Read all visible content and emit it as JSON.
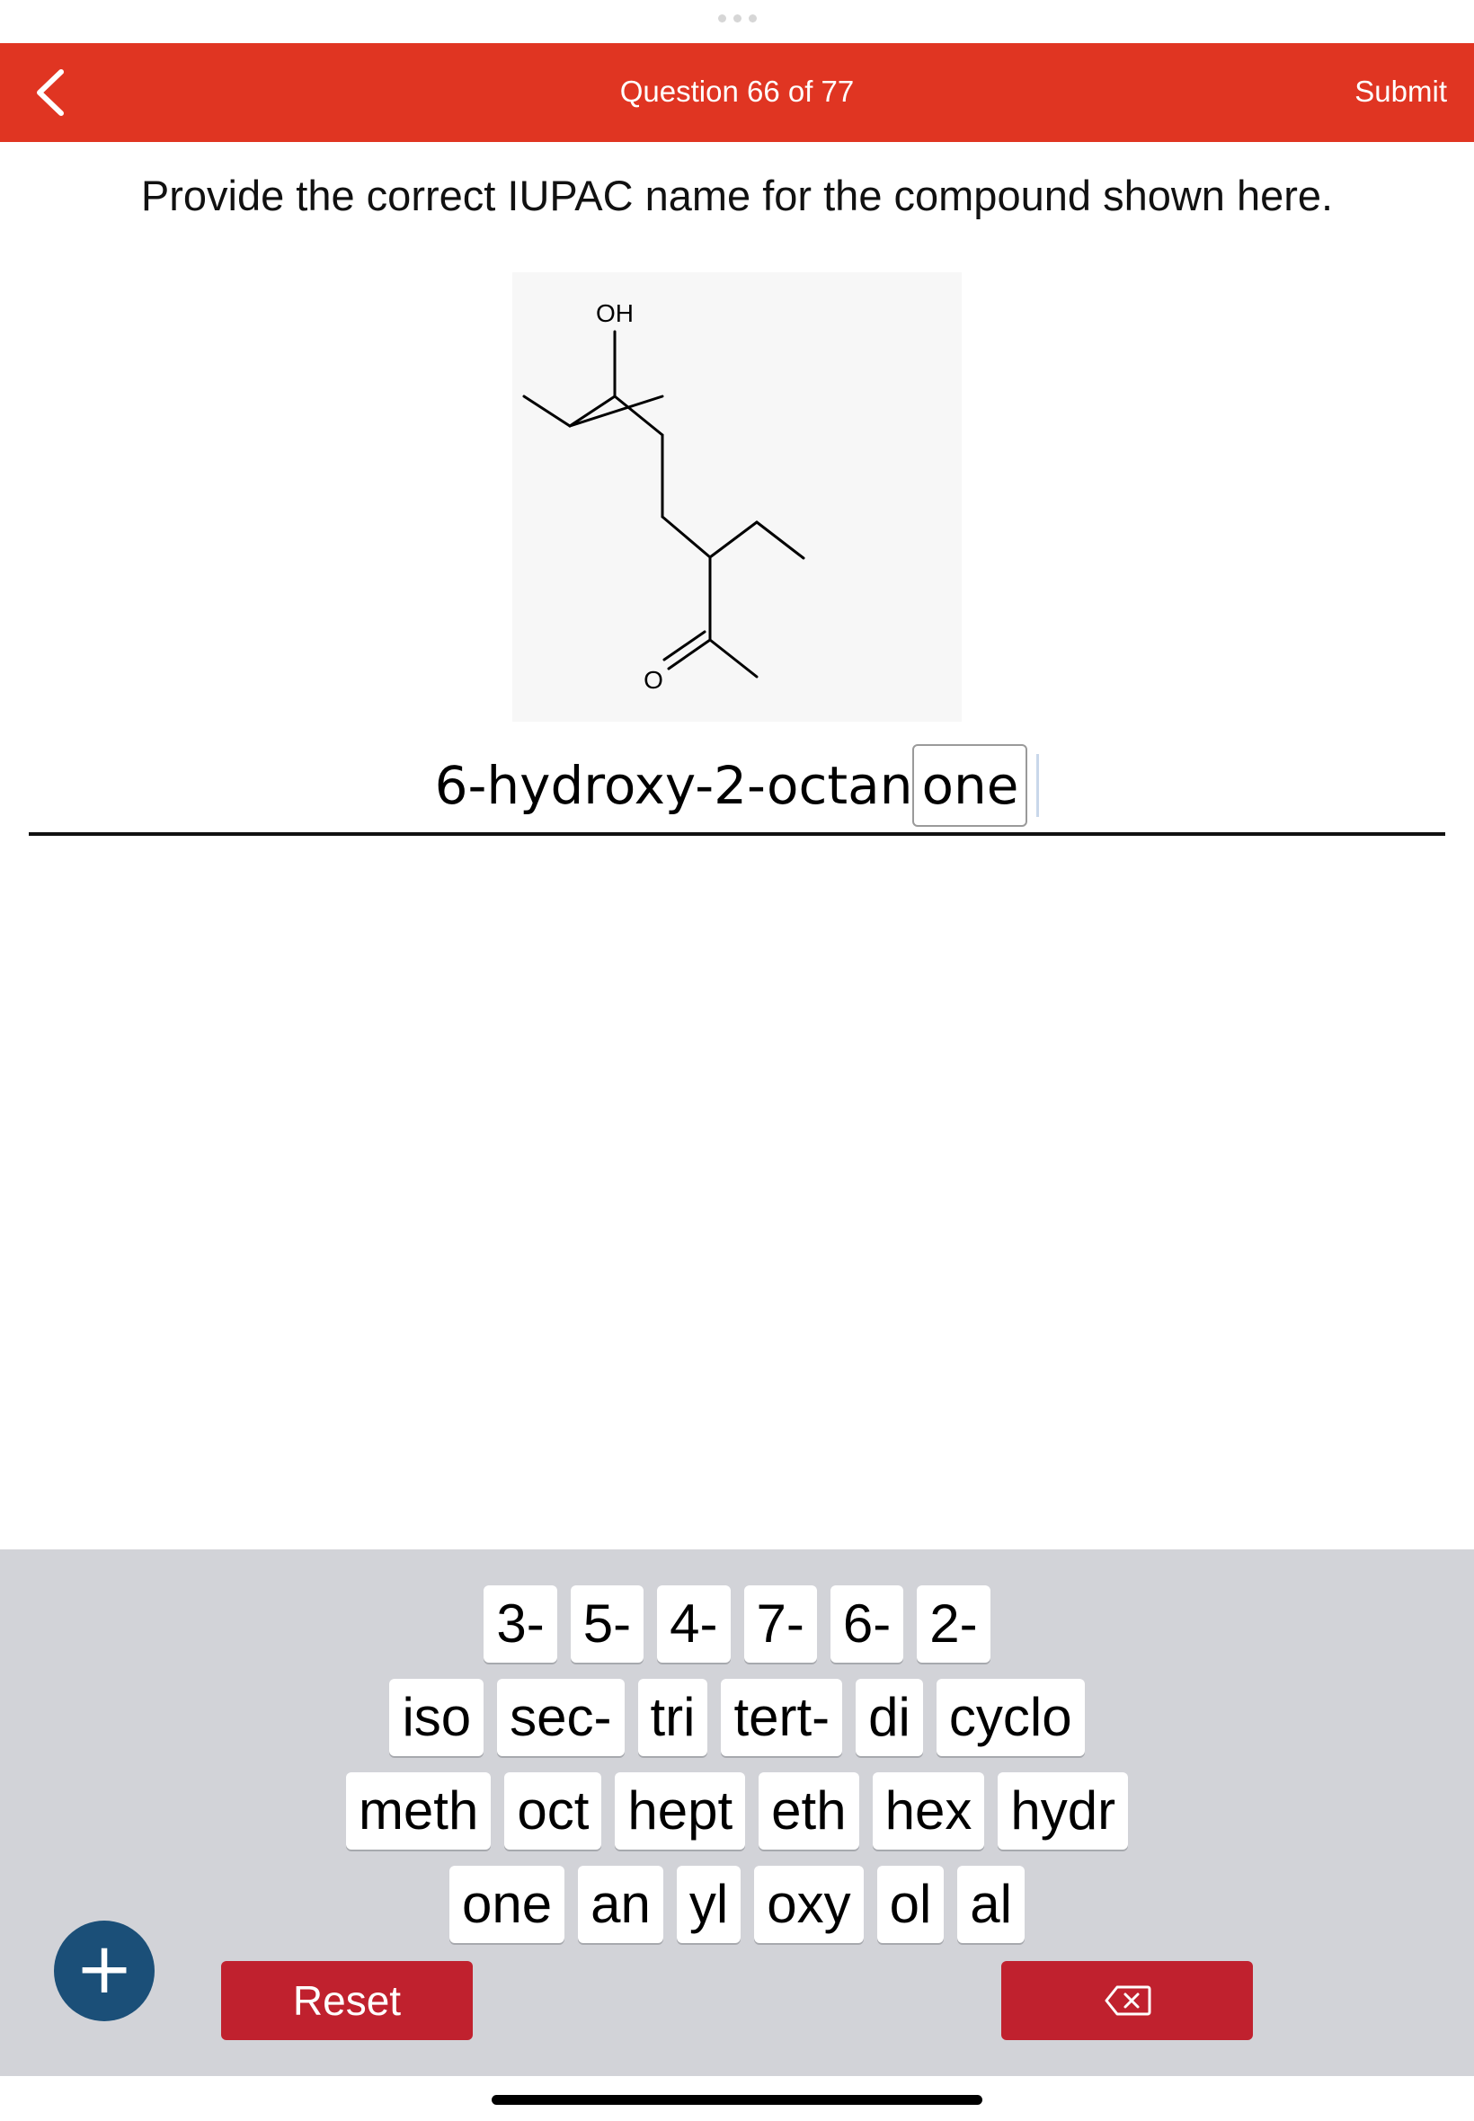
{
  "header": {
    "title": "Question 66 of 77",
    "submit_label": "Submit",
    "color": "#e03522"
  },
  "question": {
    "prompt": "Provide the correct IUPAC name for the compound shown here."
  },
  "structure": {
    "oh_label": "OH",
    "o_label": "O"
  },
  "answer": {
    "text": "6-hydroxy-2-octan",
    "selected_token": "one"
  },
  "keyboard": {
    "rows": [
      [
        "3-",
        "5-",
        "4-",
        "7-",
        "6-",
        "2-"
      ],
      [
        "iso",
        "sec-",
        "tri",
        "tert-",
        "di",
        "cyclo"
      ],
      [
        "meth",
        "oct",
        "hept",
        "eth",
        "hex",
        "hydr"
      ],
      [
        "one",
        "an",
        "yl",
        "oxy",
        "ol",
        "al"
      ]
    ],
    "reset_label": "Reset",
    "background": "#d2d3d8",
    "action_color": "#c0212e"
  },
  "icons": {
    "back": "chevron-left-icon",
    "add": "plus-icon",
    "delete": "backspace-icon"
  }
}
